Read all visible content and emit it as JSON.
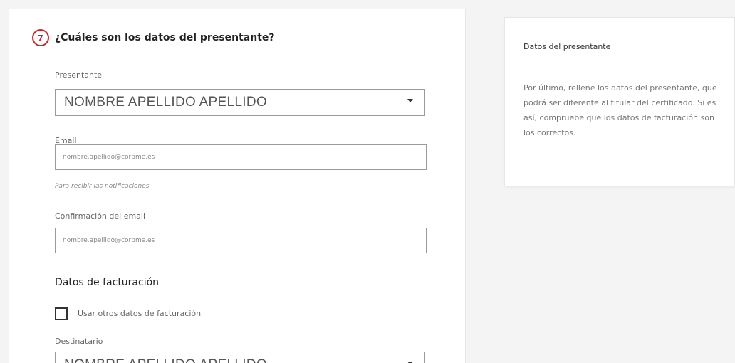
{
  "step": {
    "number": "7",
    "title": "¿Cuáles son los datos del presentante?"
  },
  "presentante": {
    "label": "Presentante",
    "selected": "NOMBRE APELLIDO APELLIDO"
  },
  "email": {
    "label": "Email",
    "placeholder": "nombre.apellido@corpme.es",
    "hint": "Para recibir las notificaciones"
  },
  "email_confirm": {
    "label": "Confirmación del email",
    "placeholder": "nombre.apellido@corpme.es"
  },
  "billing": {
    "title": "Datos de facturación",
    "checkbox_label": "Usar otros datos de facturación",
    "checked": false
  },
  "destinatario": {
    "label": "Destinatario",
    "selected": "NOMBRE APELLIDO APELLIDO"
  },
  "side_panel": {
    "title": "Datos del presentante",
    "text": "Por último, rellene los datos del presentante, que podrá ser diferente al titular del certificado. Si es así, compruebe que los datos de facturación son los correctos."
  },
  "colors": {
    "accent": "#c0292f",
    "background": "#f4f4f4",
    "card": "#ffffff"
  }
}
